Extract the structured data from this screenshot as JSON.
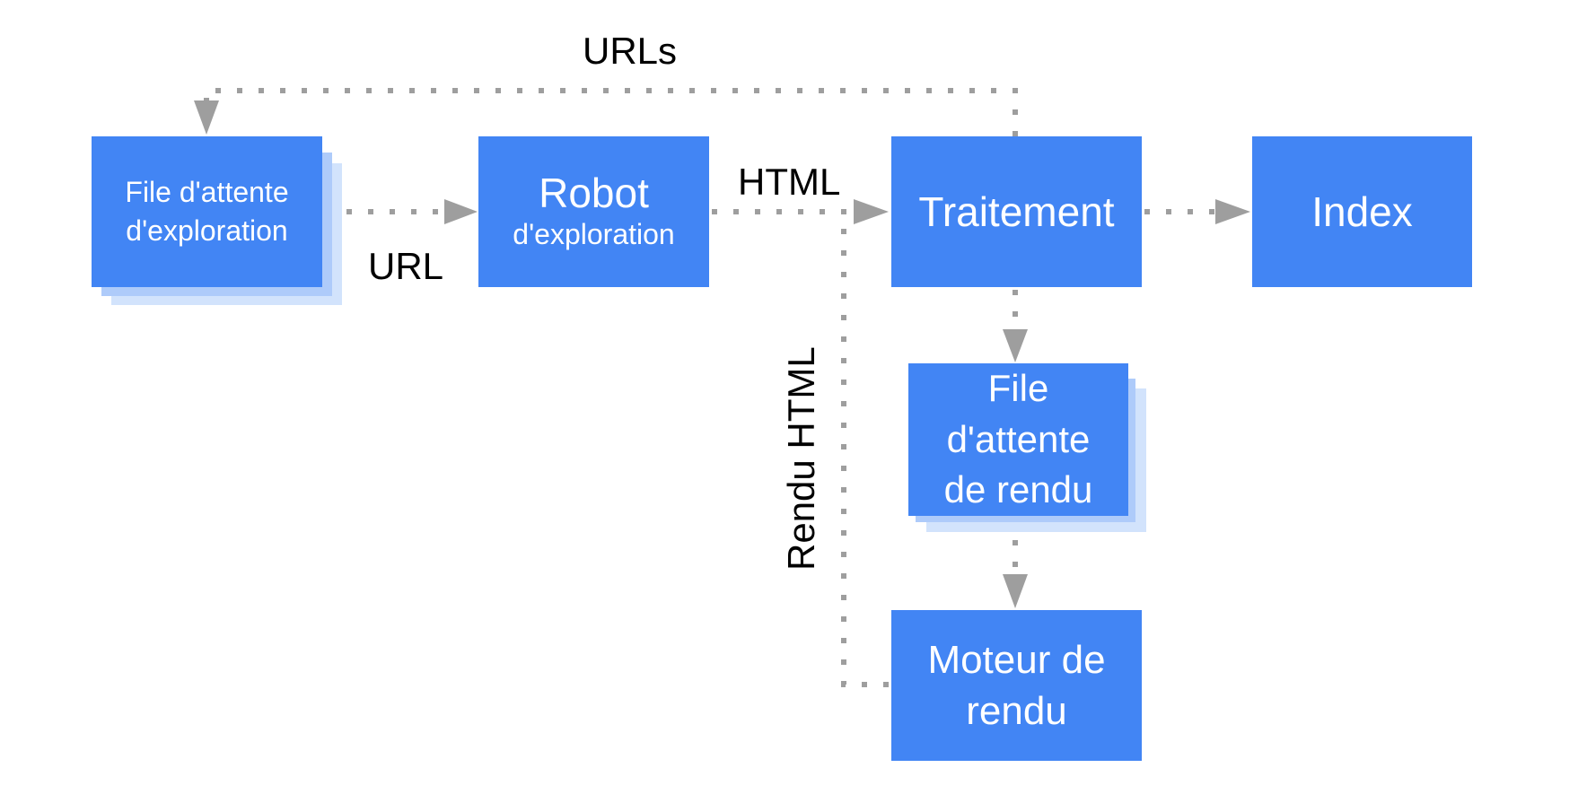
{
  "diagram": {
    "colors": {
      "box": "#4285f4",
      "box_text": "#ffffff",
      "shadow_near": "#aecbfa",
      "shadow_far": "#d2e3fc",
      "connector": "#9e9e9e",
      "label_text": "#000000"
    },
    "nodes": {
      "crawl_queue": {
        "line1": "File d'attente",
        "line2": "d'exploration"
      },
      "crawler": {
        "line1": "Robot",
        "line2": "d'exploration"
      },
      "processing": {
        "line1": "Traitement"
      },
      "index": {
        "line1": "Index"
      },
      "render_queue": {
        "line1": "File",
        "line2": "d'attente",
        "line3": "de rendu"
      },
      "renderer": {
        "line1": "Moteur de",
        "line2": "rendu"
      }
    },
    "edge_labels": {
      "urls": "URLs",
      "url": "URL",
      "html": "HTML",
      "rendered_html": "Rendu HTML"
    },
    "edges": [
      {
        "from": "crawl_queue",
        "to": "crawler",
        "label": "URL"
      },
      {
        "from": "crawler",
        "to": "processing",
        "label": "HTML"
      },
      {
        "from": "processing",
        "to": "index",
        "label": ""
      },
      {
        "from": "processing",
        "to": "crawl_queue",
        "label": "URLs"
      },
      {
        "from": "processing",
        "to": "render_queue",
        "label": ""
      },
      {
        "from": "render_queue",
        "to": "renderer",
        "label": ""
      },
      {
        "from": "renderer",
        "to": "processing",
        "label": "Rendu HTML"
      }
    ]
  }
}
